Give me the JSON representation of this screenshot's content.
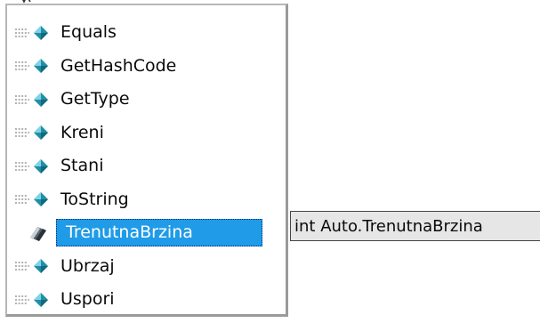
{
  "intellisense": {
    "members": [
      {
        "label": "Equals",
        "icon": "method-icon"
      },
      {
        "label": "GetHashCode",
        "icon": "method-icon"
      },
      {
        "label": "GetType",
        "icon": "method-icon"
      },
      {
        "label": "Kreni",
        "icon": "method-icon"
      },
      {
        "label": "Stani",
        "icon": "method-icon"
      },
      {
        "label": "ToString",
        "icon": "method-icon"
      },
      {
        "label": "TrenutnaBrzina",
        "icon": "property-icon",
        "selected": true
      },
      {
        "label": "Ubrzaj",
        "icon": "method-icon"
      },
      {
        "label": "Uspori",
        "icon": "method-icon"
      }
    ],
    "tooltip": "int Auto.TrenutnaBrzina"
  },
  "colors": {
    "selection": "#1f9be8",
    "method_icon": "#1f8fa6",
    "property_icon": "#5a6470",
    "tooltip_bg": "#e6e6e6"
  }
}
